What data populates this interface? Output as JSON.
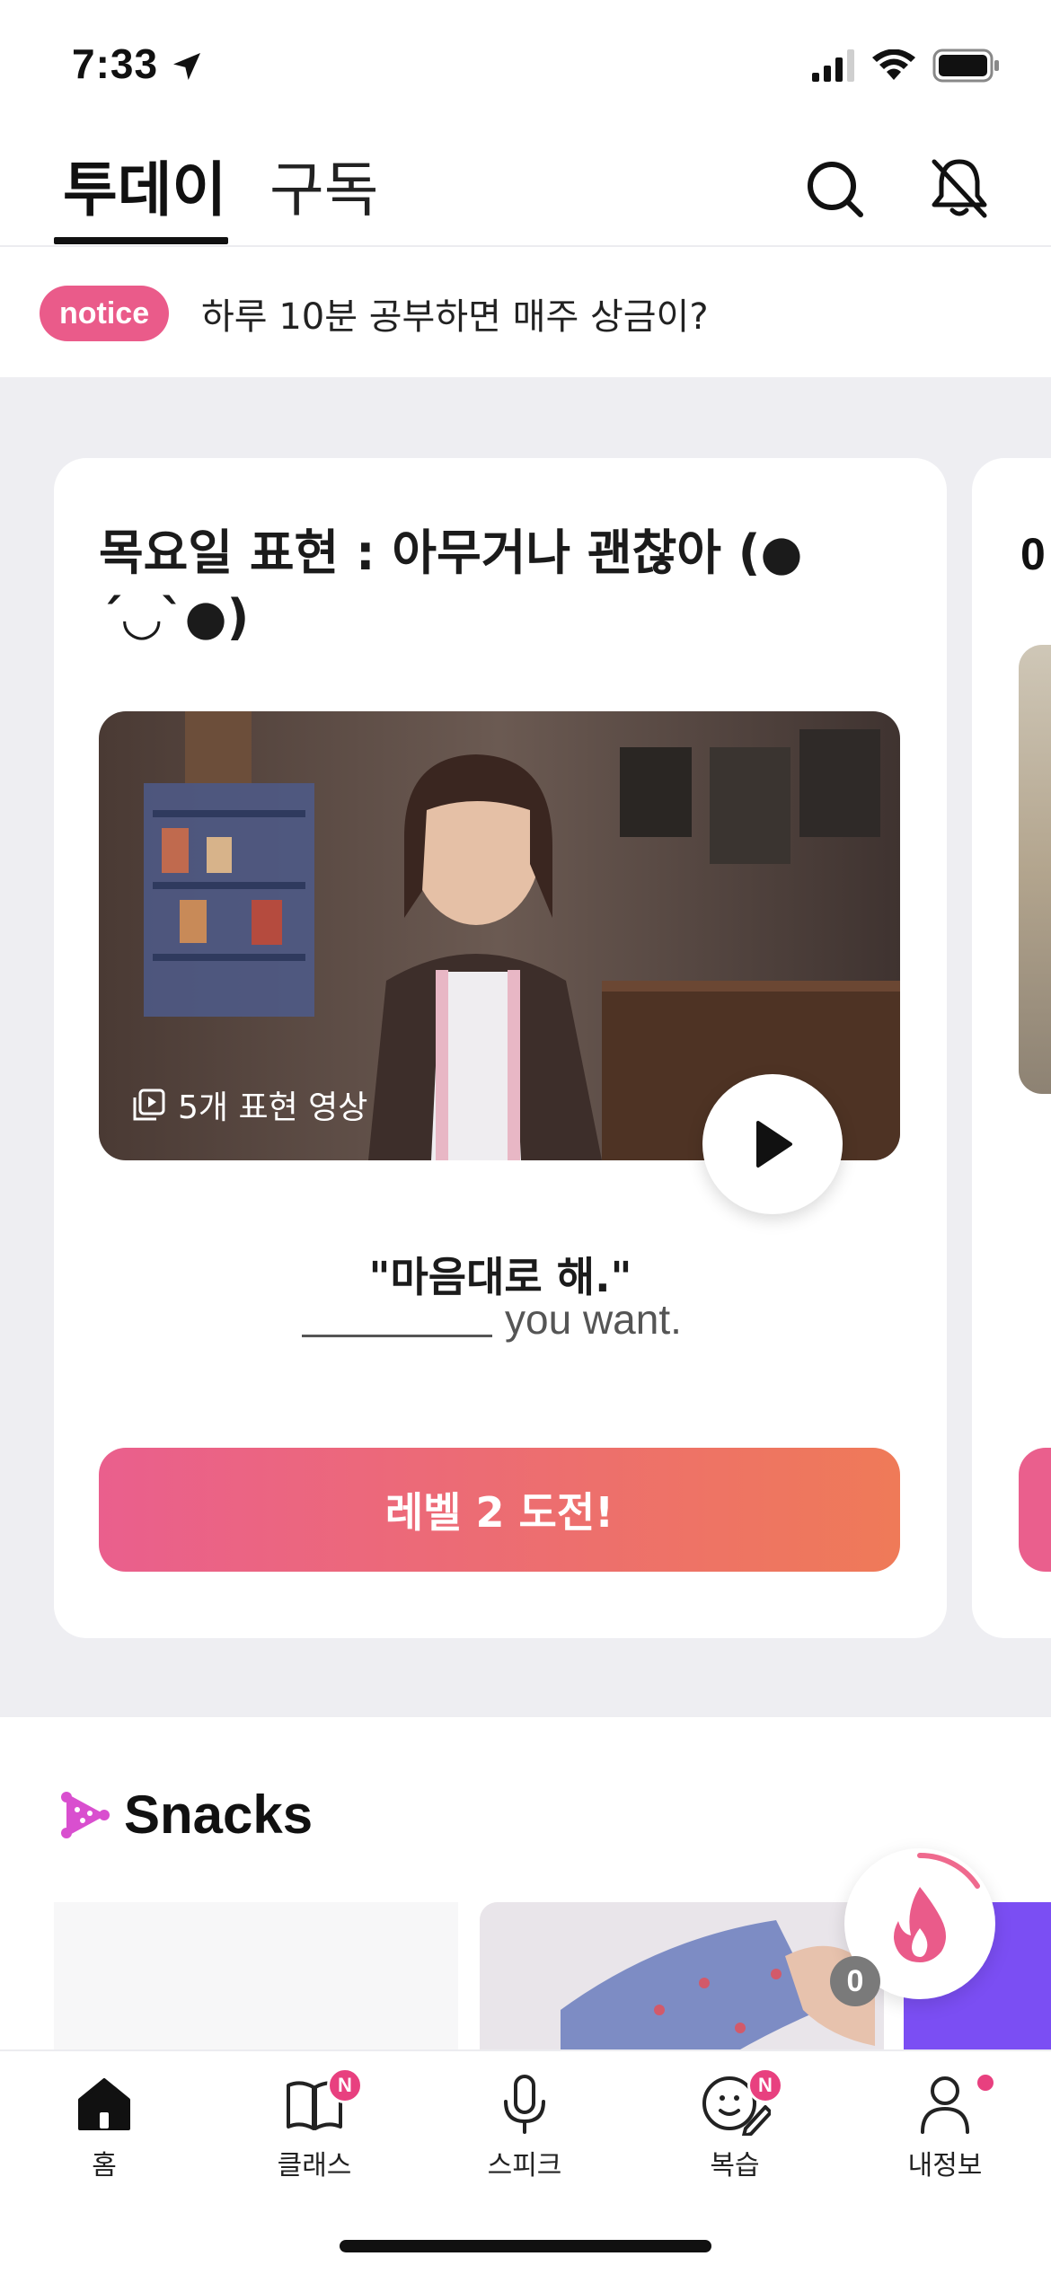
{
  "status_bar": {
    "time": "7:33"
  },
  "top_nav": {
    "tabs": [
      {
        "label": "투데이"
      },
      {
        "label": "구독"
      }
    ]
  },
  "notice": {
    "badge": "notice",
    "text": "하루 10분 공부하면 매주 상금이?"
  },
  "card": {
    "title": "목요일 표현 : 아무거나 괜찮아 (●´◡`●)",
    "video_caption": "5개 표현 영상",
    "quote": "\"마음대로 해.\"",
    "answer_suffix": "you want.",
    "cta": "레벨 2 도전!"
  },
  "next_card": {
    "title_fragment": "0"
  },
  "snacks": {
    "title": "Snacks"
  },
  "streak": {
    "count": "0"
  },
  "bottom_tabs": [
    {
      "label": "홈",
      "icon": "home-icon"
    },
    {
      "label": "클래스",
      "icon": "book-icon",
      "badge": "N"
    },
    {
      "label": "스피크",
      "icon": "mic-icon"
    },
    {
      "label": "복습",
      "icon": "review-icon",
      "badge": "N"
    },
    {
      "label": "내정보",
      "icon": "profile-icon"
    }
  ],
  "colors": {
    "accent_pink": "#ea5b8a",
    "cta_gradient_end": "#ef7a58",
    "purple": "#7b4ef3",
    "background_grey": "#eeeef2"
  }
}
